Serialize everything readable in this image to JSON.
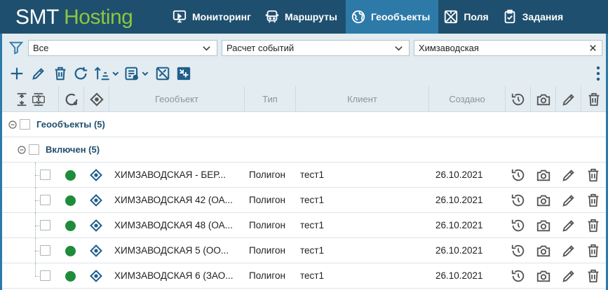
{
  "header": {
    "logo_part1": "SMT",
    "logo_part2": "Hosting",
    "nav": [
      {
        "label": "Мониторинг",
        "icon": "monitor-icon",
        "active": false
      },
      {
        "label": "Маршруты",
        "icon": "bus-icon",
        "active": false
      },
      {
        "label": "Геообъекты",
        "icon": "globe-icon",
        "active": true
      },
      {
        "label": "Поля",
        "icon": "field-icon",
        "active": false
      },
      {
        "label": "Задания",
        "icon": "task-icon",
        "active": false
      }
    ]
  },
  "filters": {
    "select1": "Все",
    "select2": "Расчет событий",
    "search": "Химзаводская"
  },
  "toolbar": {
    "icons": [
      "add-icon",
      "edit-icon",
      "delete-icon",
      "refresh-icon",
      "sort-icon",
      "report-icon",
      "map-off-icon",
      "export-icon",
      "more-icon"
    ]
  },
  "grid": {
    "columns": {
      "geoobject": "Геообъект",
      "type": "Тип",
      "client": "Клиент",
      "created": "Создано"
    },
    "group_level1": "Геообъекты (5)",
    "group_level2": "Включен (5)",
    "rows": [
      {
        "name": "ХИМЗАВОДСКАЯ - БЕР...",
        "type": "Полигон",
        "client": "тест1",
        "created": "26.10.2021"
      },
      {
        "name": "ХИМЗАВОДСКАЯ 42 (ОА...",
        "type": "Полигон",
        "client": "тест1",
        "created": "26.10.2021"
      },
      {
        "name": "ХИМЗАВОДСКАЯ 48 (ОА...",
        "type": "Полигон",
        "client": "тест1",
        "created": "26.10.2021"
      },
      {
        "name": "ХИМЗАВОДСКАЯ 5 (ОО...",
        "type": "Полигон",
        "client": "тест1",
        "created": "26.10.2021"
      },
      {
        "name": "ХИМЗАВОДСКАЯ 6 (ЗАО...",
        "type": "Полигон",
        "client": "тест1",
        "created": "26.10.2021"
      }
    ]
  },
  "colors": {
    "header_bg": "#1f4f6e",
    "accent": "#2d7aa8",
    "logo_green": "#8dc63f",
    "status_green": "#1e8c3a"
  }
}
